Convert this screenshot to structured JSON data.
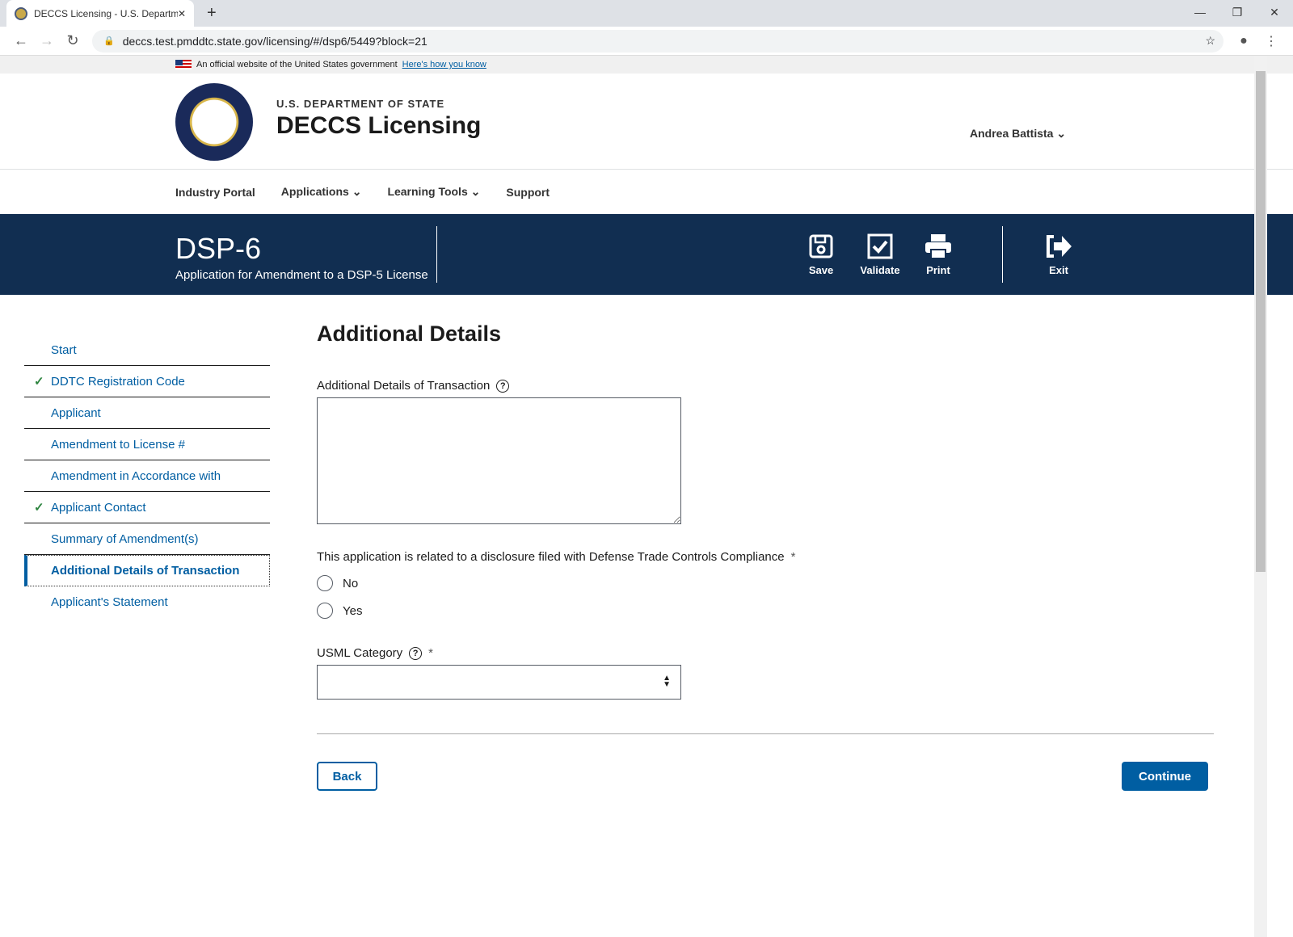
{
  "browser": {
    "tab_title": "DECCS Licensing - U.S. Departme",
    "url": "deccs.test.pmddtc.state.gov/licensing/#/dsp6/5449?block=21"
  },
  "banner": {
    "text": "An official website of the United States government",
    "link": "Here's how you know"
  },
  "header": {
    "department": "U.S. DEPARTMENT OF STATE",
    "app_name": "DECCS Licensing",
    "user": "Andrea Battista"
  },
  "nav": {
    "items": [
      "Industry Portal",
      "Applications",
      "Learning Tools",
      "Support"
    ]
  },
  "form_header": {
    "title": "DSP-6",
    "subtitle": "Application for Amendment to a DSP-5 License",
    "save": "Save",
    "validate": "Validate",
    "print": "Print",
    "exit": "Exit"
  },
  "sidebar": {
    "items": [
      {
        "label": "Start",
        "checked": false
      },
      {
        "label": "DDTC Registration Code",
        "checked": true
      },
      {
        "label": "Applicant",
        "checked": false
      },
      {
        "label": "Amendment to License #",
        "checked": false
      },
      {
        "label": "Amendment in Accordance with",
        "checked": false
      },
      {
        "label": "Applicant Contact",
        "checked": true
      },
      {
        "label": "Summary of Amendment(s)",
        "checked": false
      },
      {
        "label": "Additional Details of Transaction",
        "checked": false,
        "active": true
      },
      {
        "label": "Applicant's Statement",
        "checked": false
      }
    ]
  },
  "main": {
    "title": "Additional Details",
    "details_label": "Additional Details of Transaction",
    "details_value": "",
    "disclosure_label": "This application is related to a disclosure filed with Defense Trade Controls Compliance",
    "required": "*",
    "options": [
      "No",
      "Yes"
    ],
    "usml_label": "USML Category",
    "usml_value": "",
    "back": "Back",
    "continue": "Continue"
  },
  "colors": {
    "band": "#112e51",
    "primary": "#005ea2",
    "check": "#2e8540"
  }
}
